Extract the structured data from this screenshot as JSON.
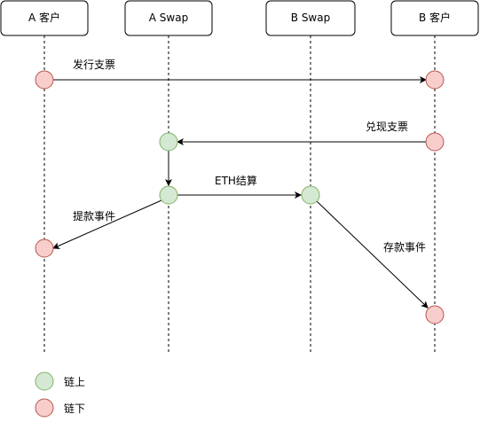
{
  "participants": [
    {
      "label": "A 客户"
    },
    {
      "label": "A Swap"
    },
    {
      "label": "B Swap"
    },
    {
      "label": "B 客户"
    }
  ],
  "messages": {
    "issue_check": "发行支票",
    "redeem_check": "兑现支票",
    "eth_settle": "ETH结算",
    "withdraw_event": "提款事件",
    "deposit_event": "存款事件"
  },
  "legend": {
    "onchain": "链上",
    "offchain": "链下"
  },
  "colors": {
    "onchain_fill": "#d5e8d4",
    "onchain_stroke": "#82b366",
    "offchain_fill": "#f8cecc",
    "offchain_stroke": "#b85450",
    "lifeline": "#000000",
    "arrow": "#000000"
  }
}
